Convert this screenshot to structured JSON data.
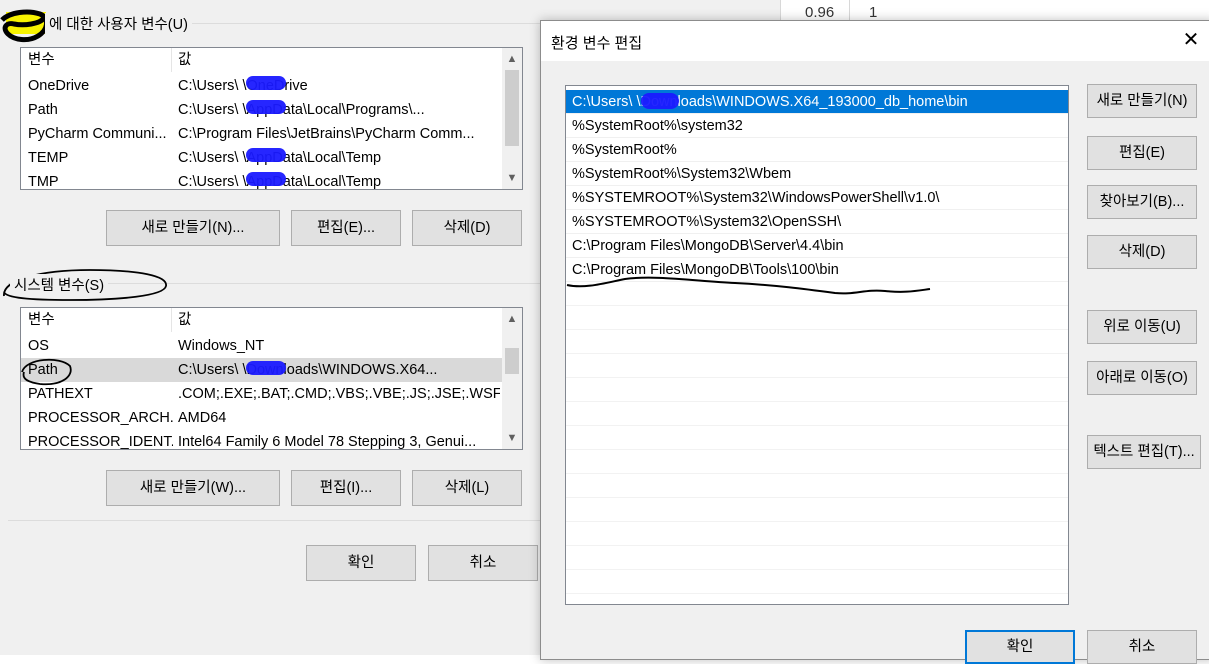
{
  "user_vars": {
    "group_label": "에 대한 사용자 변수(U)",
    "header": {
      "name": "변수",
      "value": "값"
    },
    "rows": [
      {
        "name": "OneDrive",
        "value": "C:\\Users\\      \\OneDrive"
      },
      {
        "name": "Path",
        "value": "C:\\Users\\      \\AppData\\Local\\Programs\\..."
      },
      {
        "name": "PyCharm Communi...",
        "value": "C:\\Program Files\\JetBrains\\PyCharm Comm..."
      },
      {
        "name": "TEMP",
        "value": "C:\\Users\\      \\AppData\\Local\\Temp"
      },
      {
        "name": "TMP",
        "value": "C:\\Users\\      \\AppData\\Local\\Temp"
      }
    ],
    "buttons": {
      "new": "새로 만들기(N)...",
      "edit": "편집(E)...",
      "delete": "삭제(D)"
    }
  },
  "system_vars": {
    "group_label": "시스템 변수(S)",
    "header": {
      "name": "변수",
      "value": "값"
    },
    "rows": [
      {
        "name": "OS",
        "value": "Windows_NT"
      },
      {
        "name": "Path",
        "value": "C:\\Users\\      \\Downloads\\WINDOWS.X64..."
      },
      {
        "name": "PATHEXT",
        "value": ".COM;.EXE;.BAT;.CMD;.VBS;.VBE;.JS;.JSE;.WSF;...."
      },
      {
        "name": "PROCESSOR_ARCH...",
        "value": "AMD64"
      },
      {
        "name": "PROCESSOR_IDENT...",
        "value": "Intel64 Family 6 Model 78 Stepping 3, Genui..."
      }
    ],
    "buttons": {
      "new": "새로 만들기(W)...",
      "edit": "편집(I)...",
      "delete": "삭제(L)"
    }
  },
  "bg_footer": {
    "ok": "확인",
    "cancel": "취소"
  },
  "bg_cells": {
    "a": "0.96",
    "b": "1"
  },
  "dialog": {
    "title": "환경 변수 편집",
    "close_glyph": "✕",
    "paths": [
      "C:\\Users\\      \\Downloads\\WINDOWS.X64_193000_db_home\\bin",
      "%SystemRoot%\\system32",
      "%SystemRoot%",
      "%SystemRoot%\\System32\\Wbem",
      "%SYSTEMROOT%\\System32\\WindowsPowerShell\\v1.0\\",
      "%SYSTEMROOT%\\System32\\OpenSSH\\",
      "C:\\Program Files\\MongoDB\\Server\\4.4\\bin",
      "C:\\Program Files\\MongoDB\\Tools\\100\\bin"
    ],
    "buttons": {
      "new": "새로 만들기(N)",
      "edit": "편집(E)",
      "browse": "찾아보기(B)...",
      "delete": "삭제(D)",
      "move_up": "위로 이동(U)",
      "move_down": "아래로 이동(O)",
      "edit_text": "텍스트 편집(T)...",
      "ok": "확인",
      "cancel": "취소"
    }
  },
  "colors": {
    "selection": "#0078d7",
    "redaction": "#1a1aff",
    "highlight": "#f7f200"
  }
}
